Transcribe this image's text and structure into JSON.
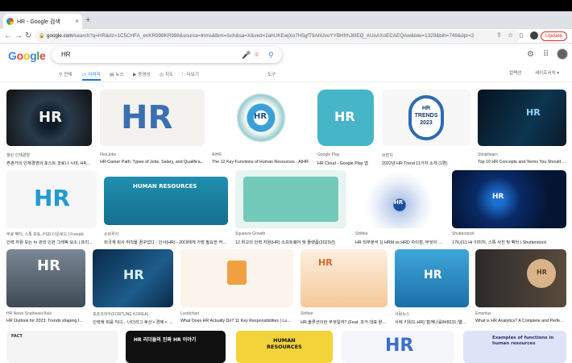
{
  "browser": {
    "tab_title": "HR - Google 검색",
    "tab_close": "×",
    "new_tab": "+",
    "url_host": "google.com",
    "url_rest": "/search?q=HR&rlz=1C5CHFA_enKR998KR998&source=lnms&tbm=isch&sa=X&ved=2ahUKEwjXo7H5gfT9AhUvoYYBHfrhJ8IEQ_AUoAXoECAEQAw&biw=1329&bih=749&dpr=2",
    "update_label": "Update",
    "back": "←",
    "forward": "→",
    "reload": "↻"
  },
  "search": {
    "logo": [
      "G",
      "o",
      "o",
      "g",
      "l",
      "e"
    ],
    "query": "HR",
    "tabs": [
      {
        "icon": "⚲",
        "label": "전체"
      },
      {
        "icon": "▭",
        "label": "이미지"
      },
      {
        "icon": "▤",
        "label": "뉴스"
      },
      {
        "icon": "▶",
        "label": "동영상"
      },
      {
        "icon": "◎",
        "label": "지도"
      },
      {
        "icon": "⋮",
        "label": "더보기"
      }
    ],
    "tools": "도구",
    "collection": "컬렉션",
    "safe_search": "세이프서치 ▾"
  },
  "results": [
    {
      "src": "챌린 인재경영",
      "cap": "흔괜가의 인재경영의 포스트 코로나 시대, HR 역할들..."
    },
    {
      "src": "FlexJobs",
      "cap": "HR Career Path: Types of Jobs, Salary, and Qualifica..."
    },
    {
      "src": "AIHR",
      "cap": "The 12 Key Functions of Human Resources - AIHR"
    },
    {
      "src": "Google Play",
      "cap": "HR Cloud - Google Play 앱"
    },
    {
      "src": "브런치",
      "cap": "2022년 HR Trend 11가지 소개 (1편)"
    },
    {
      "src": "Simplilearn",
      "cap": "Top 10 HR Concepts and Terms You Should ..."
    },
    {
      "src": "무료 벡터, 스톡 포토, PSD 다운로드 | Freepik",
      "cap": "인력 자원 모는 hr 관리 인관 그래픽 요소 | 프리미엄 ..."
    },
    {
      "src": "슈퍼루키",
      "cap": "외국계 회사 취직을 꿈꾸었다 - 인사(HR) - 20대에게 가장 필요한 커리어 정..."
    },
    {
      "src": "Squeeze Growth",
      "cap": "12 최고의 인력 자원(HR) 소프트웨어 및 플랫폼(2023년)"
    },
    {
      "src": "Shiftee",
      "cap": "HR 직무분석 1] HRM vs HRD 차이점, 무엇이 다를..."
    },
    {
      "src": "Shutterstock",
      "cap": "176,611 Hr 이미지, 스톡 사진 및 벡터 | Shutterstock"
    },
    {
      "src": "HR News Southeast Asia",
      "cap": "HR Outlook for 2023: Trends shaping the..."
    },
    {
      "src": "포춘코리아(FORTUNE KOREA)",
      "cap": "인력에 회를 지녀... 너더리그 후산 • 경제 < Indu..."
    },
    {
      "src": "Lucidchart",
      "cap": "What Does HR Actually Do? 11 Key Responsibilities | Lucid..."
    },
    {
      "src": "Shiftee",
      "cap": "HR 솔루션이란 무엇일까? (Feat. 과거 대표 분야 정..."
    },
    {
      "src": "사람뉴스",
      "cap": "사례 키워드-HR] '함께나를8#8231;'엘리트..."
    },
    {
      "src": "Emeritus",
      "cap": "What is HR Analytics? A Complete and Perfect..."
    }
  ],
  "thumb_text": {
    "hr": "HR",
    "trends": "HR\nTRENDS\n2023",
    "human_resources": "HUMAN RESOURCES",
    "human_res_yellow": "HUMAN\nRESOURCES",
    "hr_leader": "HR 리더들의 진짜 HR 이야기",
    "examples": "Examples of functions in human resources",
    "fact": "FACT"
  }
}
